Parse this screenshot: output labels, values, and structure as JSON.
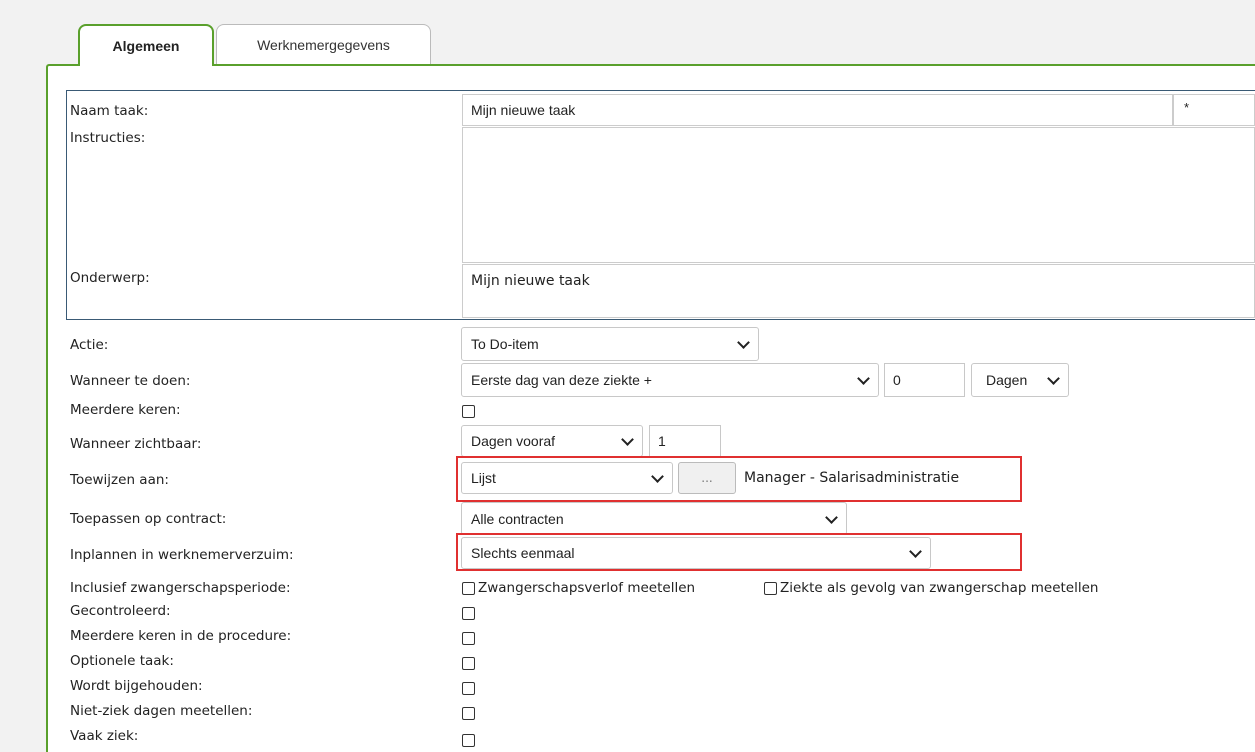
{
  "tabs": [
    {
      "label": "Algemeen"
    },
    {
      "label": "Werknemergegevens"
    }
  ],
  "task": {
    "name_label": "Naam taak:",
    "name_value": "Mijn nieuwe taak",
    "required_mark": "*",
    "instructions_label": "Instructies:",
    "instructions_value": "",
    "subject_label": "Onderwerp:",
    "subject_value": "Mijn nieuwe taak"
  },
  "form": {
    "actie": {
      "label": "Actie:",
      "value": "To Do-item"
    },
    "wanneer_doen": {
      "label": "Wanneer te doen:",
      "value": "Eerste dag van deze ziekte +",
      "number": "0",
      "unit": "Dagen"
    },
    "meerdere_keren": {
      "label": "Meerdere keren:",
      "checked": false
    },
    "wanneer_zichtbaar": {
      "label": "Wanneer zichtbaar:",
      "value": "Dagen vooraf",
      "number": "1"
    },
    "toewijzen": {
      "label": "Toewijzen aan:",
      "value": "Lijst",
      "button": "...",
      "assignee": "Manager - Salarisadministratie"
    },
    "toepassen": {
      "label": "Toepassen op contract:",
      "value": "Alle contracten"
    },
    "inplannen": {
      "label": "Inplannen in werknemerverzuim:",
      "value": "Slechts eenmaal"
    },
    "zwangerschap": {
      "label": "Inclusief zwangerschapsperiode:",
      "option1": "Zwangerschapsverlof meetellen",
      "option2": "Ziekte als gevolg van zwangerschap meetellen"
    },
    "gecontroleerd": {
      "label": "Gecontroleerd:",
      "checked": false
    },
    "meerdere_procedure": {
      "label": "Meerdere keren in de procedure:",
      "checked": false
    },
    "optionele_taak": {
      "label": "Optionele taak:",
      "checked": false
    },
    "bijgehouden": {
      "label": "Wordt bijgehouden:",
      "checked": false
    },
    "niet_ziek": {
      "label": "Niet-ziek dagen meetellen:",
      "checked": false
    },
    "vaak_ziek": {
      "label": "Vaak ziek:",
      "checked": false
    }
  },
  "colors": {
    "accent": "#5aa02c",
    "highlight": "#e03030",
    "box_border": "#3a5a75"
  }
}
